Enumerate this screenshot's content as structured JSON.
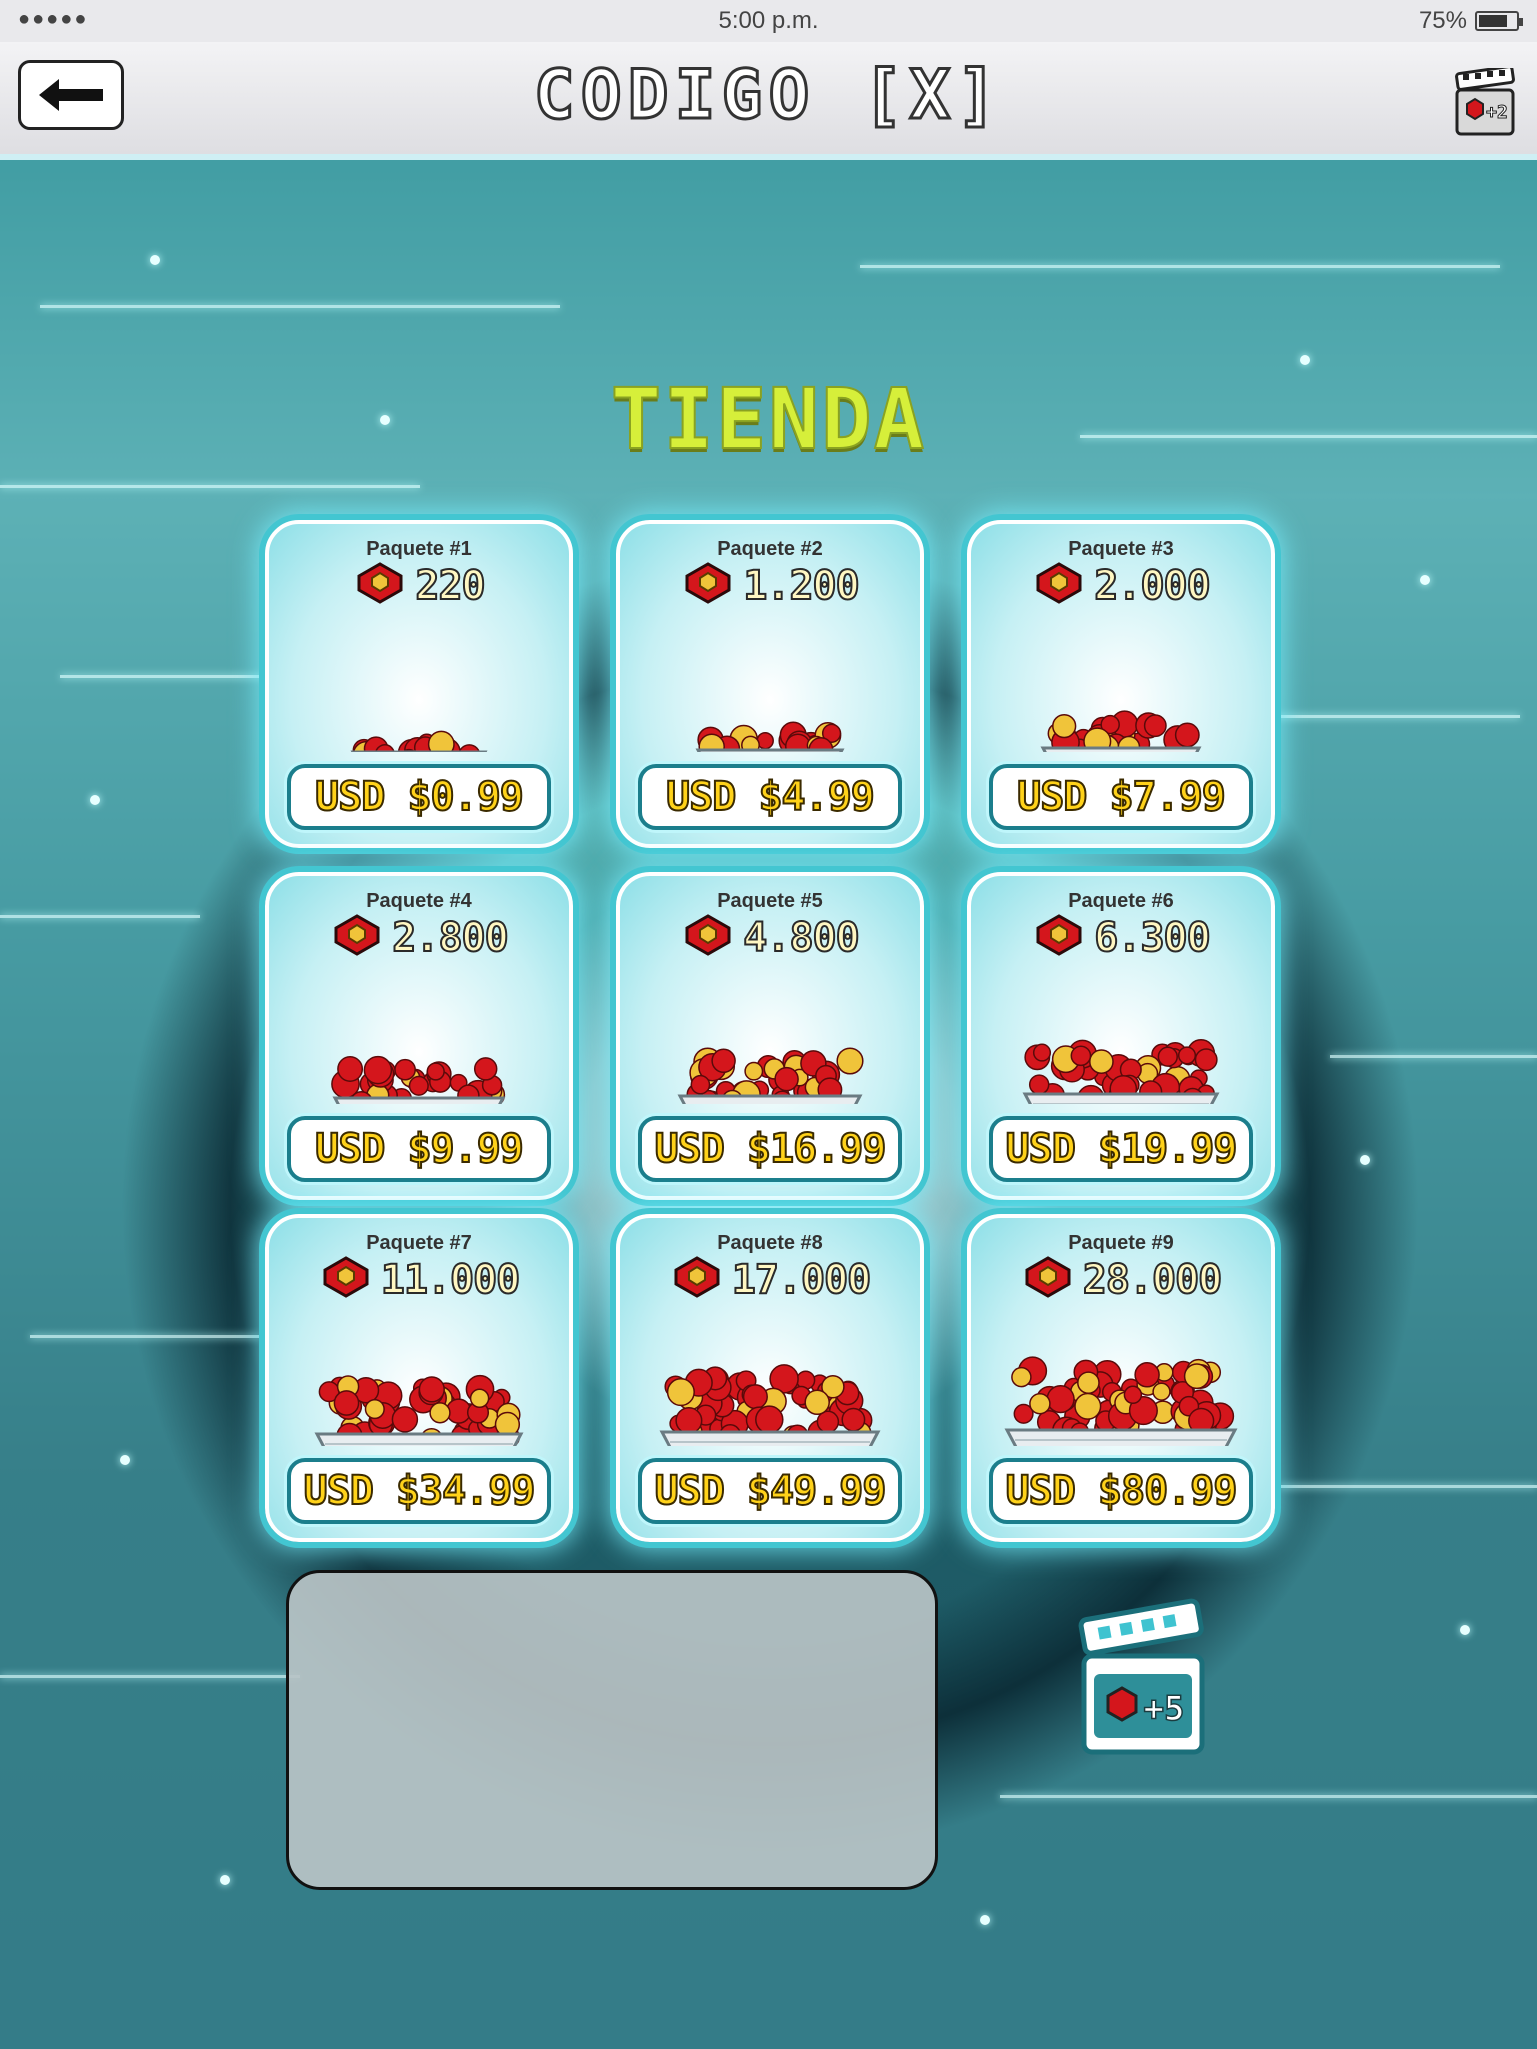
{
  "status_bar": {
    "signal": "●●●●●",
    "time": "5:00 p.m.",
    "battery": "75%"
  },
  "header": {
    "title": "CODIGO [X]",
    "back_icon": "arrow-left-icon",
    "video_reward_badge": "+2"
  },
  "section_title": "TIENDA",
  "packages": [
    {
      "name": "Paquete #1",
      "amount": "220",
      "price": "USD $0.99",
      "size": 1
    },
    {
      "name": "Paquete #2",
      "amount": "1.200",
      "price": "USD $4.99",
      "size": 2
    },
    {
      "name": "Paquete #3",
      "amount": "2.000",
      "price": "USD $7.99",
      "size": 3
    },
    {
      "name": "Paquete #4",
      "amount": "2.800",
      "price": "USD $9.99",
      "size": 4
    },
    {
      "name": "Paquete #5",
      "amount": "4.800",
      "price": "USD $16.99",
      "size": 5
    },
    {
      "name": "Paquete #6",
      "amount": "6.300",
      "price": "USD $19.99",
      "size": 6
    },
    {
      "name": "Paquete #7",
      "amount": "11.000",
      "price": "USD $34.99",
      "size": 7
    },
    {
      "name": "Paquete #8",
      "amount": "17.000",
      "price": "USD $49.99",
      "size": 8
    },
    {
      "name": "Paquete #9",
      "amount": "28.000",
      "price": "USD $80.99",
      "size": 9
    }
  ],
  "video_reward": {
    "badge": "+5",
    "icon": "clapperboard-icon"
  },
  "colors": {
    "accent": "#43c6d1",
    "title": "#d6ef3a",
    "price": "#ffd21a",
    "gem": "#d4161c"
  }
}
